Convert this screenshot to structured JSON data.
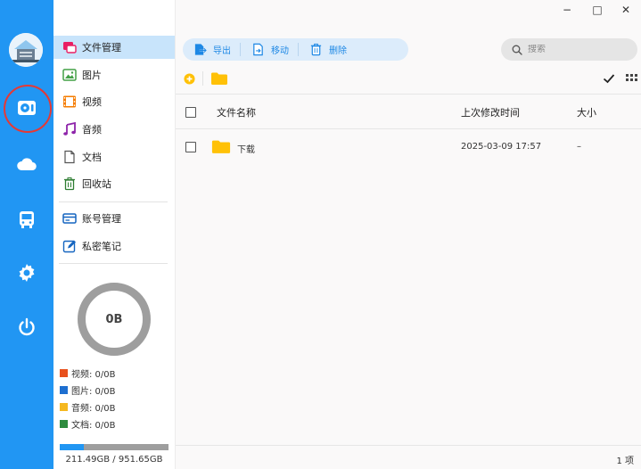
{
  "window": {
    "minimize": "−",
    "maximize": "□",
    "close": "✕"
  },
  "rail": {
    "items": [
      {
        "name": "local-files",
        "active": true
      },
      {
        "name": "cloud",
        "active": false
      },
      {
        "name": "transfer",
        "active": false
      },
      {
        "name": "settings",
        "active": false
      },
      {
        "name": "power",
        "active": false
      }
    ]
  },
  "sidebar": {
    "items": [
      {
        "label": "文件管理",
        "icon": "file-manager-icon"
      },
      {
        "label": "图片",
        "icon": "image-icon"
      },
      {
        "label": "视频",
        "icon": "video-icon"
      },
      {
        "label": "音频",
        "icon": "music-icon"
      },
      {
        "label": "文档",
        "icon": "document-icon"
      },
      {
        "label": "回收站",
        "icon": "trash-icon"
      },
      {
        "label": "账号管理",
        "icon": "account-icon"
      },
      {
        "label": "私密笔记",
        "icon": "note-icon"
      }
    ],
    "storage_total": "0B",
    "legend": [
      {
        "label": "视频: 0/0B",
        "color": "#e8511d"
      },
      {
        "label": "图片: 0/0B",
        "color": "#1e6fd0"
      },
      {
        "label": "音频: 0/0B",
        "color": "#f5b820"
      },
      {
        "label": "文档: 0/0B",
        "color": "#2e8b3e"
      }
    ],
    "storage_text": "211.49GB / 951.65GB",
    "storage_used_fraction": 0.222
  },
  "toolbar": {
    "export_label": "导出",
    "move_label": "移动",
    "delete_label": "删除"
  },
  "search": {
    "placeholder": "搜索"
  },
  "table": {
    "columns": {
      "name": "文件名称",
      "modified": "上次修改时间",
      "size": "大小"
    },
    "rows": [
      {
        "name": "下载",
        "modified": "2025-03-09 17:57",
        "size": "–"
      }
    ]
  },
  "footer": {
    "count": "1 项"
  },
  "colors": {
    "accent": "#2196f3",
    "folder": "#ffc107",
    "selected_bg": "#c8e4fb"
  }
}
